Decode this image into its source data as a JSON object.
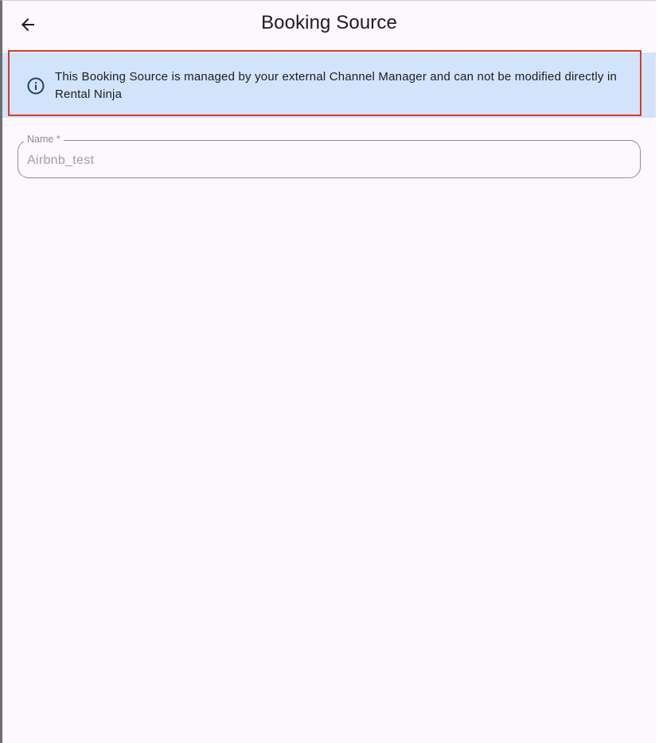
{
  "app_bar": {
    "title": "Booking Source",
    "back_icon": "arrow-left-icon"
  },
  "banner": {
    "icon": "info-icon",
    "message": "This Booking Source is managed by your external Channel Manager and can not be modified directly in Rental Ninja"
  },
  "form": {
    "name_field": {
      "label": "Name *",
      "value": "Airbnb_test"
    }
  },
  "colors": {
    "background": "#fdf8fd",
    "banner_background": "#d2e4fb",
    "banner_icon": "#1f3f6e",
    "highlight_border": "#d43d22",
    "field_border": "#8d8d93",
    "text_primary": "#1c1b1f",
    "text_disabled": "#9f9da3"
  }
}
